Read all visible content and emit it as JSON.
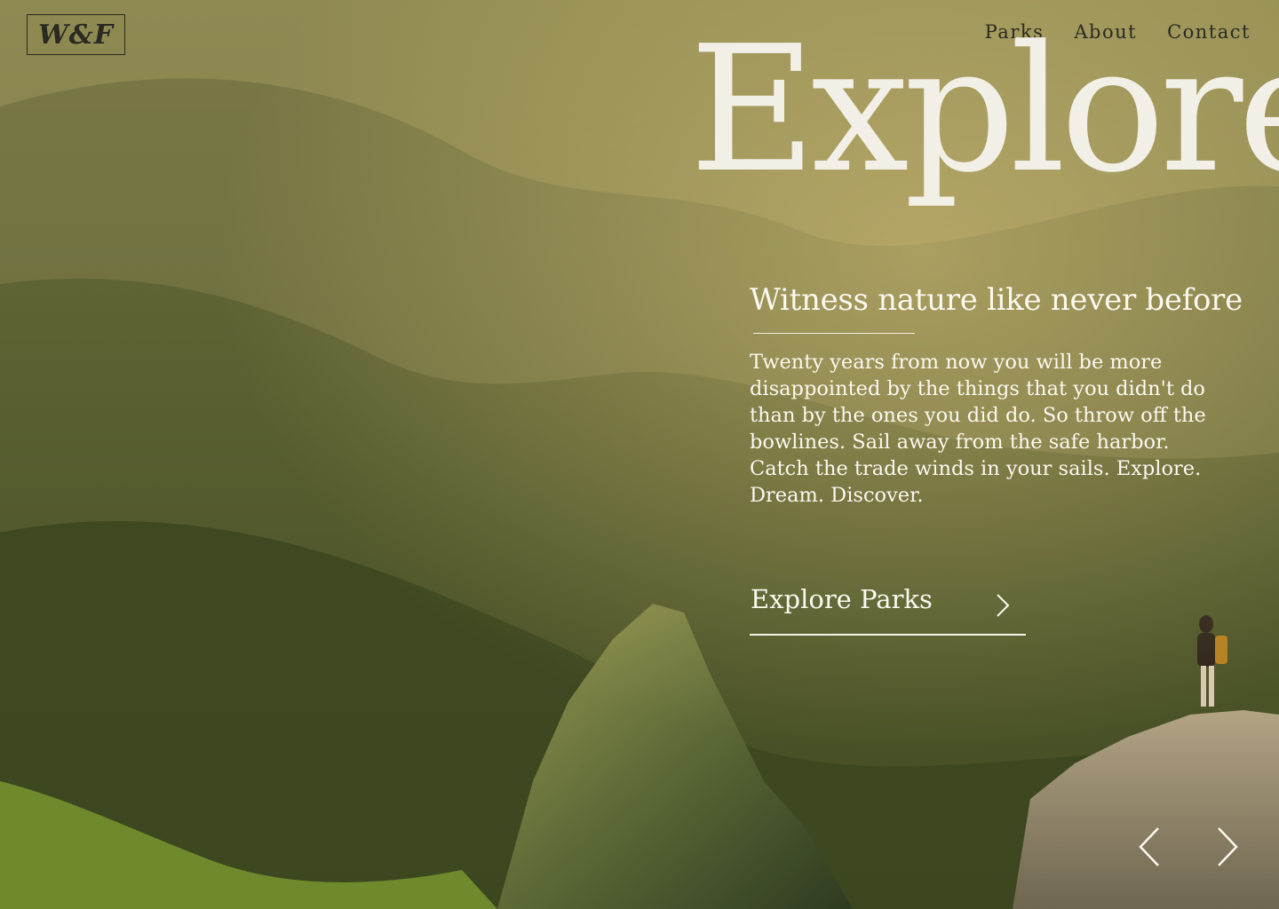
{
  "brand": {
    "logo_text": "W&F"
  },
  "nav": {
    "items": [
      "Parks",
      "About",
      "Contact"
    ]
  },
  "hero": {
    "title": "Explore",
    "subtitle": "Witness nature like never before",
    "quote": "Twenty years from now you will be more disappointed by the things that you didn't do than by the ones you did do. So throw off the bowlines. Sail away from the safe harbor. Catch the trade winds in your sails. Explore. Dream. Discover.",
    "cta_label": "Explore Parks"
  },
  "icons": {
    "cta": "chevron-right-icon",
    "prev": "chevron-left-icon",
    "next": "chevron-right-icon"
  },
  "colors": {
    "text_light": "#fbf8ef",
    "text_dark": "#2a2a22",
    "forest_dark": "#3f4a22",
    "sky_haze": "#8a8650"
  }
}
